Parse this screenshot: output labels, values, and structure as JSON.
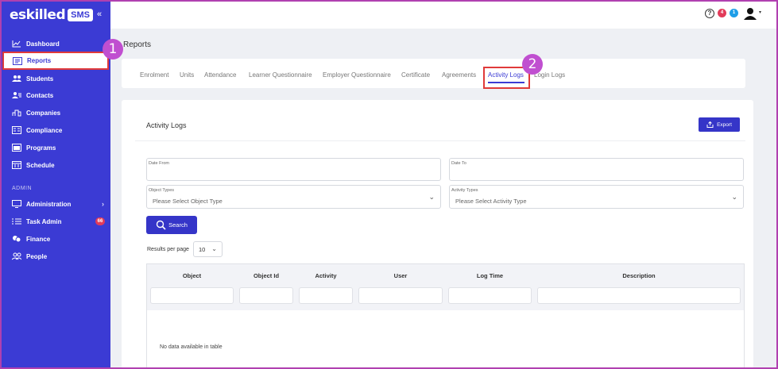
{
  "brand": {
    "logo_text": "eskilled",
    "logo_badge": "SMS",
    "collapse_glyph": "«"
  },
  "sidebar": {
    "items": [
      {
        "label": "Dashboard",
        "icon": "chart-line-icon"
      },
      {
        "label": "Reports",
        "icon": "report-icon",
        "active": true
      },
      {
        "label": "Students",
        "icon": "students-icon"
      },
      {
        "label": "Contacts",
        "icon": "contacts-icon"
      },
      {
        "label": "Companies",
        "icon": "companies-icon"
      },
      {
        "label": "Compliance",
        "icon": "compliance-icon"
      },
      {
        "label": "Programs",
        "icon": "programs-icon"
      },
      {
        "label": "Schedule",
        "icon": "schedule-icon"
      }
    ],
    "admin_section_label": "ADMIN",
    "admin_items": [
      {
        "label": "Administration",
        "icon": "monitor-icon",
        "has_chevron": true
      },
      {
        "label": "Task Admin",
        "icon": "tasks-icon",
        "badge": "66"
      },
      {
        "label": "Finance",
        "icon": "coins-icon"
      },
      {
        "label": "People",
        "icon": "people-icon"
      }
    ]
  },
  "topbar": {
    "help_glyph": "?",
    "notification_counts": [
      "4",
      "1"
    ],
    "user_caret": "▾"
  },
  "page": {
    "title": "Reports"
  },
  "tabs": [
    {
      "label": "Enrolment"
    },
    {
      "label": "Units"
    },
    {
      "label": "Attendance"
    },
    {
      "label": "Learner Questionnaire"
    },
    {
      "label": "Employer Questionnaire"
    },
    {
      "label": "Certificate"
    },
    {
      "label": "Agreements"
    },
    {
      "label": "Activity Logs",
      "active": true
    },
    {
      "label": "Login Logs"
    }
  ],
  "callouts": {
    "one": "1",
    "two": "2"
  },
  "card": {
    "title": "Activity Logs",
    "export_label": "Export",
    "filters": {
      "date_from_label": "Date From",
      "date_to_label": "Date To",
      "object_types_label": "Object Types",
      "object_types_placeholder": "Please Select Object Type",
      "activity_types_label": "Activity Types",
      "activity_types_placeholder": "Please Select Activity Type"
    },
    "search_label": "Search",
    "results_per_page_label": "Results per page",
    "results_per_page_value": "10"
  },
  "table": {
    "columns": [
      "Object",
      "Object Id",
      "Activity",
      "User",
      "Log Time",
      "Description"
    ],
    "empty_message": "No data available in table"
  },
  "colors": {
    "sidebar": "#3b3bd4",
    "primary_button": "#3535c8",
    "highlight_box": "#e03a3a",
    "callout": "#c04fd0"
  }
}
